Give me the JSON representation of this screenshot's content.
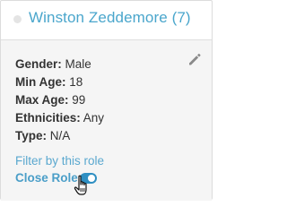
{
  "role": {
    "title": "Winston Zeddemore (7)"
  },
  "fields": [
    {
      "label": "Gender:",
      "value": "Male"
    },
    {
      "label": "Min Age:",
      "value": "18"
    },
    {
      "label": "Max Age:",
      "value": "99"
    },
    {
      "label": "Ethnicities:",
      "value": "Any"
    },
    {
      "label": "Type:",
      "value": "N/A"
    }
  ],
  "actions": {
    "filter_label": "Filter by this role",
    "close_role_label": "Close Role",
    "close_role_toggle_on": true
  },
  "icons": {
    "status": "status-dot-icon",
    "edit": "pencil-icon",
    "cursor": "hand-pointer-cursor"
  },
  "colors": {
    "title": "#4aa6cc",
    "link": "#5aa8cf",
    "toggle": "#2f8fc2",
    "body_bg": "#f5f5f5"
  }
}
